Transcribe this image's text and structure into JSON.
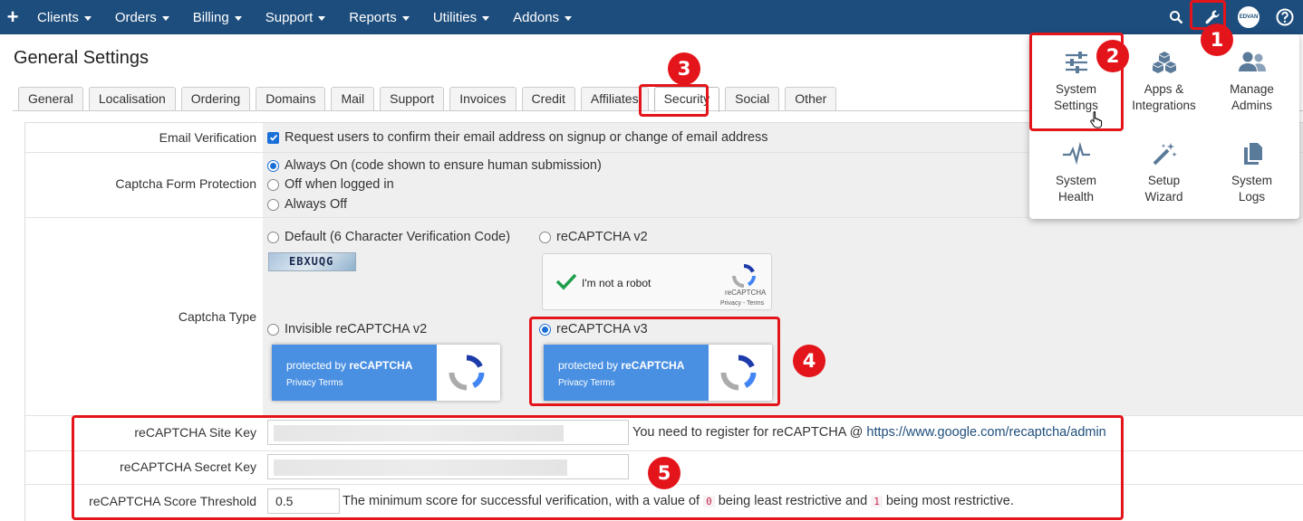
{
  "nav": {
    "plus": "+",
    "items": [
      "Clients",
      "Orders",
      "Billing",
      "Support",
      "Reports",
      "Utilities",
      "Addons"
    ],
    "avatar_text": "EDVAN",
    "icons": [
      "search-icon",
      "wrench-icon",
      "avatar",
      "help-icon"
    ]
  },
  "page": {
    "title": "General Settings"
  },
  "tabs": [
    "General",
    "Localisation",
    "Ordering",
    "Domains",
    "Mail",
    "Support",
    "Invoices",
    "Credit",
    "Affiliates",
    "Security",
    "Social",
    "Other"
  ],
  "active_tab": "Security",
  "settings": {
    "email_verification": {
      "label": "Email Verification",
      "option": "Request users to confirm their email address on signup or change of email address",
      "checked": true
    },
    "captcha_protection": {
      "label": "Captcha Form Protection",
      "options": [
        "Always On (code shown to ensure human submission)",
        "Off when logged in",
        "Always Off"
      ],
      "selected": "Always On (code shown to ensure human submission)"
    },
    "captcha_type": {
      "label": "Captcha Type",
      "options": {
        "default": "Default (6 Character Verification Code)",
        "v2": "reCAPTCHA v2",
        "invisible": "Invisible reCAPTCHA v2",
        "v3": "reCAPTCHA v3"
      },
      "selected": "reCAPTCHA v3",
      "sample_code": "EBXUQG",
      "robot_text": "I'm not a robot",
      "robot_brand": "reCAPTCHA",
      "robot_links": "Privacy - Terms",
      "badge_text_prefix": "protected by ",
      "badge_text_brand": "reCAPTCHA",
      "badge_links": "Privacy  Terms"
    },
    "site_key": {
      "label": "reCAPTCHA Site Key",
      "help_prefix": "You need to register for reCAPTCHA @ ",
      "help_link": "https://www.google.com/recaptcha/admin"
    },
    "secret_key": {
      "label": "reCAPTCHA Secret Key"
    },
    "score_threshold": {
      "label": "reCAPTCHA Score Threshold",
      "value": "0.5",
      "help_a": "The minimum score for successful verification, with a value of ",
      "code_a": "0",
      "help_b": " being least restrictive and ",
      "code_b": "1",
      "help_c": " being most restrictive."
    }
  },
  "dropdown": {
    "items": [
      {
        "label_1": "System",
        "label_2": "Settings",
        "icon": "sliders-icon"
      },
      {
        "label_1": "Apps &",
        "label_2": "Integrations",
        "icon": "cubes-icon"
      },
      {
        "label_1": "Manage",
        "label_2": "Admins",
        "icon": "users-icon"
      },
      {
        "label_1": "System",
        "label_2": "Health",
        "icon": "heartbeat-icon"
      },
      {
        "label_1": "Setup",
        "label_2": "Wizard",
        "icon": "magic-wand-icon"
      },
      {
        "label_1": "System",
        "label_2": "Logs",
        "icon": "files-icon"
      }
    ]
  },
  "annotations": [
    "1",
    "2",
    "3",
    "4",
    "5"
  ],
  "colors": {
    "nav_bg": "#1d4d7c",
    "highlight": "#e4141b",
    "accent": "#1a6fd8",
    "badge_blue": "#4a90e2"
  }
}
